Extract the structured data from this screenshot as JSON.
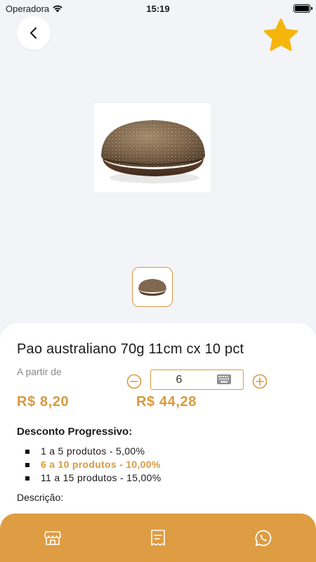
{
  "status_bar": {
    "carrier": "Operadora",
    "time": "15:19"
  },
  "product": {
    "title": "Pao australiano 70g 11cm cx 10 pct",
    "from_label": "A partir de",
    "unit_price": "R$ 8,20",
    "total_price": "R$ 44,28",
    "quantity": "6"
  },
  "discount": {
    "title": "Desconto Progressivo:",
    "tiers": [
      {
        "label": "1 a 5 produtos - 5,00%",
        "active": false
      },
      {
        "label": "6 a 10 produtos - 10,00%",
        "active": true
      },
      {
        "label": "11 a 15 produtos - 15,00%",
        "active": false
      }
    ]
  },
  "description_label": "Descrição:",
  "colors": {
    "accent": "#d89a3f",
    "bottom_bar": "#de9c43",
    "favorite_star": "#f5b50a",
    "background": "#f3f4f8"
  },
  "icons": {
    "back": "chevron-left-icon",
    "favorite": "star-icon",
    "minus": "minus-circle-icon",
    "plus": "plus-circle-icon",
    "keyboard": "keyboard-icon",
    "store": "store-icon",
    "receipt": "receipt-icon",
    "whatsapp": "whatsapp-icon"
  }
}
